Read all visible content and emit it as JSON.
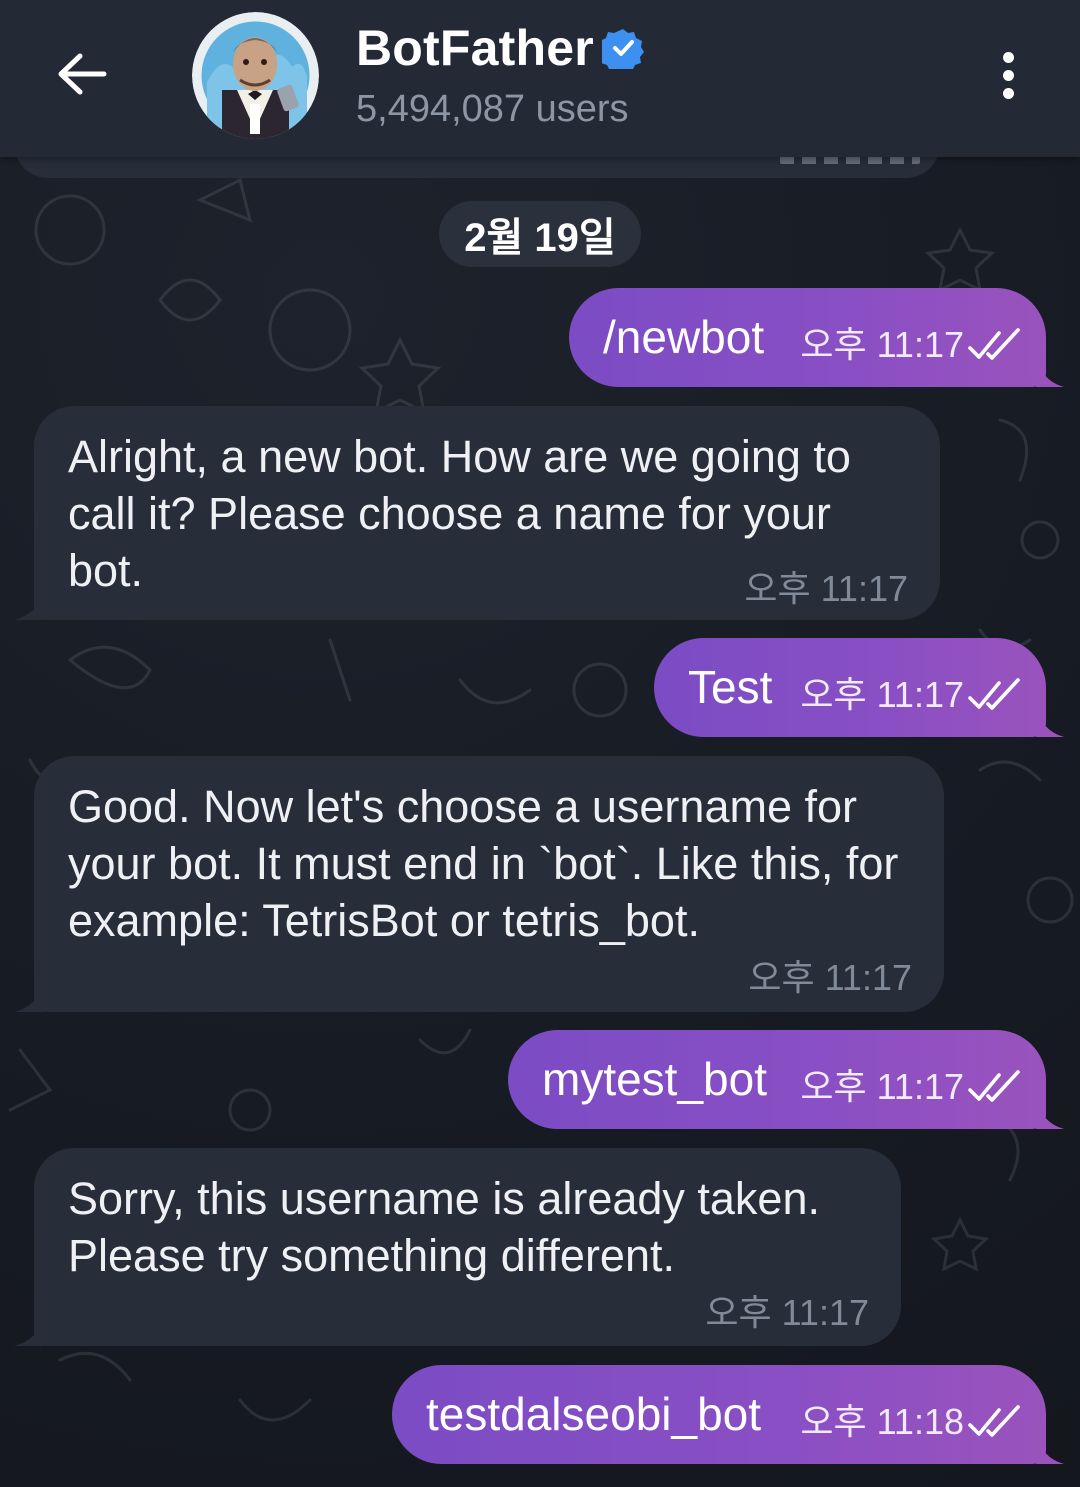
{
  "header": {
    "back_icon": "arrow-left-icon",
    "title": "BotFather",
    "verified_icon": "verified-badge-icon",
    "subtitle": "5,494,087 users",
    "menu_icon": "more-vert-icon"
  },
  "date_separator": "2월 19일",
  "messages": [
    {
      "direction": "out",
      "text": "/newbot",
      "time": "오후 11:17",
      "status": "read"
    },
    {
      "direction": "in",
      "text": "Alright, a new bot. How are we going to call it? Please choose a name for your bot.",
      "time": "오후 11:17"
    },
    {
      "direction": "out",
      "text": "Test",
      "time": "오후 11:17",
      "status": "read"
    },
    {
      "direction": "in",
      "text": "Good. Now let's choose a username for your bot. It must end in `bot`. Like this, for example: TetrisBot or tetris_bot.",
      "time": "오후 11:17"
    },
    {
      "direction": "out",
      "text": "mytest_bot",
      "time": "오후 11:17",
      "status": "read"
    },
    {
      "direction": "in",
      "text": "Sorry, this username is already taken. Please try something different.",
      "time": "오후 11:17"
    },
    {
      "direction": "out",
      "text": "testdalseobi_bot",
      "time": "오후 11:18",
      "status": "read"
    }
  ],
  "colors": {
    "header_bg": "#232935",
    "outgoing_bubble": "#8a4fc4",
    "incoming_bubble": "#272d39",
    "verified_badge": "#3d8ff0"
  }
}
